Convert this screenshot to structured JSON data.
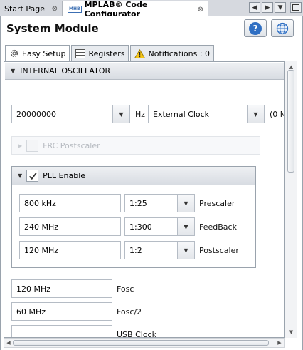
{
  "tabs": {
    "start_page": "Start Page",
    "configurator": "MPLAB® Code Configurator",
    "logo_text": "MHB",
    "close_glyph": "⊗"
  },
  "header": {
    "title": "System Module",
    "help_glyph": "?"
  },
  "subtabs": {
    "easy_setup": "Easy Setup",
    "registers": "Registers",
    "notifications": "Notifications : 0"
  },
  "oscillator": {
    "section_label": "INTERNAL OSCILLATOR",
    "frequency_value": "20000000",
    "frequency_unit": "Hz",
    "clock_source": "External Clock",
    "clock_note": "(0 M",
    "frc_postscaler_label": "FRC Postscaler"
  },
  "pll": {
    "label": "PLL Enable",
    "enabled": true,
    "rows": [
      {
        "value": "800 kHz",
        "ratio": "1:25",
        "label": "Prescaler"
      },
      {
        "value": "240 MHz",
        "ratio": "1:300",
        "label": "FeedBack"
      },
      {
        "value": "120 MHz",
        "ratio": "1:2",
        "label": "Postscaler"
      }
    ]
  },
  "outputs": [
    {
      "value": "120 MHz",
      "label": "Fosc"
    },
    {
      "value": "60 MHz",
      "label": "Fosc/2"
    },
    {
      "value": "",
      "label": "USB Clock"
    }
  ],
  "colors": {
    "accent": "#2f6fc3",
    "panel_border": "#9aa3ad",
    "header_bg": "#d6d9df"
  },
  "icons": {
    "help": "help-icon",
    "globe": "globe-icon",
    "gear": "gear-icon",
    "registers": "list-icon",
    "warning": "warning-icon"
  }
}
